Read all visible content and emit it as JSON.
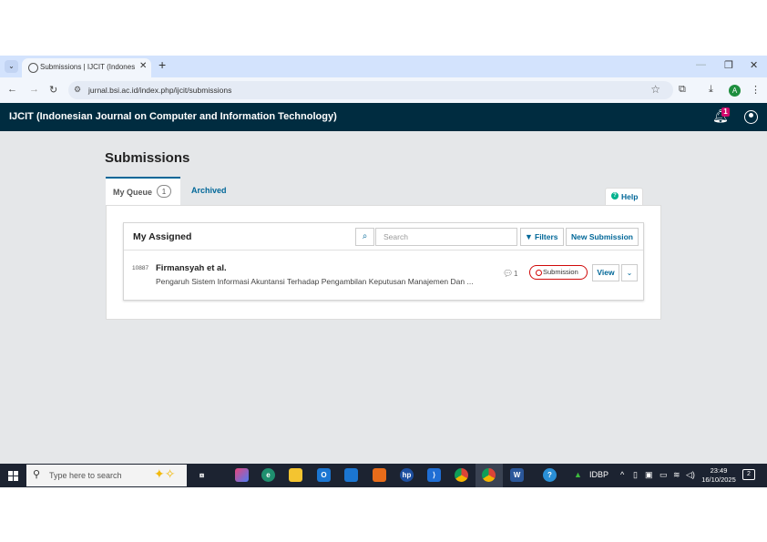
{
  "browser": {
    "tab_title": "Submissions | IJCIT (Indonesian Journal on Computer and Information Technology)",
    "url": "jurnal.bsi.ac.id/index.php/ijcit/submissions",
    "profile_initial": "A"
  },
  "site": {
    "title": "IJCIT (Indonesian Journal on Computer and Information Technology)",
    "notification_count": "1"
  },
  "page": {
    "title": "Submissions",
    "tabs": [
      {
        "label": "My Queue",
        "count": "1"
      },
      {
        "label": "Archived"
      }
    ],
    "help_label": "Help"
  },
  "list": {
    "title": "My Assigned",
    "search_placeholder": "Search",
    "filters_label": "Filters",
    "new_submission_label": "New Submission",
    "rows": [
      {
        "id": "10887",
        "author": "Firmansyah et al.",
        "title": "Pengaruh Sistem Informasi Akuntansi Terhadap Pengambilan Keputusan Manajemen Dan ...",
        "comments": "1",
        "stage": "Submission",
        "view_label": "View"
      }
    ]
  },
  "taskbar": {
    "search_placeholder": "Type here to search",
    "tray_label": "IDBP",
    "time": "23:49",
    "date": "16/10/2025",
    "notification_count": "2"
  },
  "colors": {
    "header_bg": "#002c40",
    "link": "#006798",
    "stage_red": "#d00a0a",
    "help_green": "#00b28d"
  }
}
